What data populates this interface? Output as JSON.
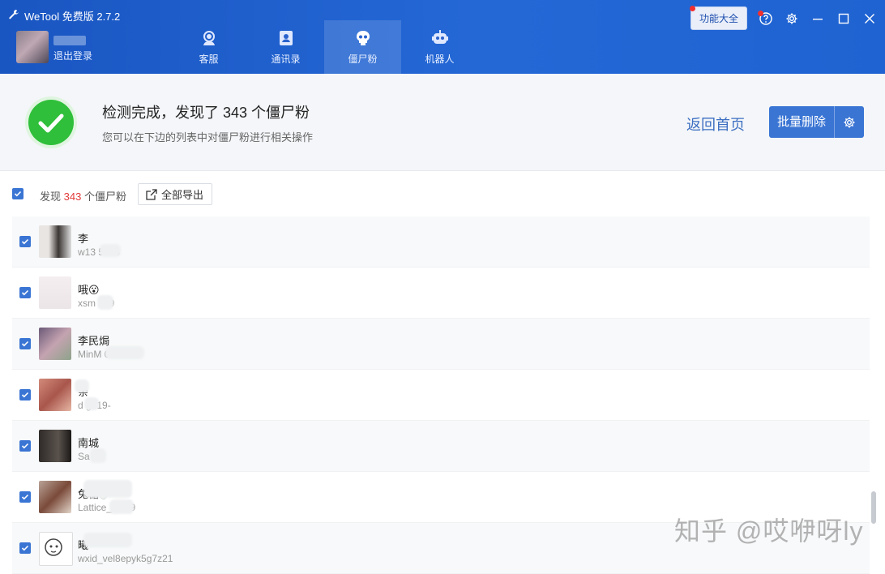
{
  "app": {
    "title": "WeTool 免费版 2.7.2"
  },
  "user": {
    "logout_label": "退出登录"
  },
  "nav": {
    "items": [
      {
        "label": "客服",
        "icon": "customer-service-icon"
      },
      {
        "label": "通讯录",
        "icon": "contacts-icon"
      },
      {
        "label": "僵尸粉",
        "icon": "skull-icon",
        "active": true
      },
      {
        "label": "机器人",
        "icon": "robot-icon"
      }
    ]
  },
  "window": {
    "feature_label": "功能大全"
  },
  "result": {
    "title": "检测完成，发现了 343 个僵尸粉",
    "subtitle": "您可以在下边的列表中对僵尸粉进行相关操作",
    "back_label": "返回首页",
    "batch_delete_label": "批量删除"
  },
  "toolbar": {
    "found_prefix": "发现",
    "found_count": "343",
    "found_suffix": "个僵尸粉",
    "export_label": "全部导出"
  },
  "contacts": [
    {
      "nickname": "李",
      "wxid": "w13      5545"
    },
    {
      "nickname": "哦😮",
      "wxid": "xsm     509"
    },
    {
      "nickname": "李民焗",
      "wxid": "MinM          07461"
    },
    {
      "nickname": " 亲",
      "wxid": "d   g819-"
    },
    {
      "nickname": "南城",
      "wxid": "Sa    4"
    },
    {
      "nickname": "               兔糖🍼",
      "wxid": "Lattice_     1109"
    },
    {
      "nickname": "            曦",
      "wxid": "wxid_vel8epyk5g7z21"
    }
  ],
  "watermark": "知乎 @哎咿呀ly",
  "colors": {
    "accent": "#3a75d4",
    "header_bg": "#1f5fcf",
    "success": "#2fbf3a",
    "count_red": "#e23b3b"
  }
}
